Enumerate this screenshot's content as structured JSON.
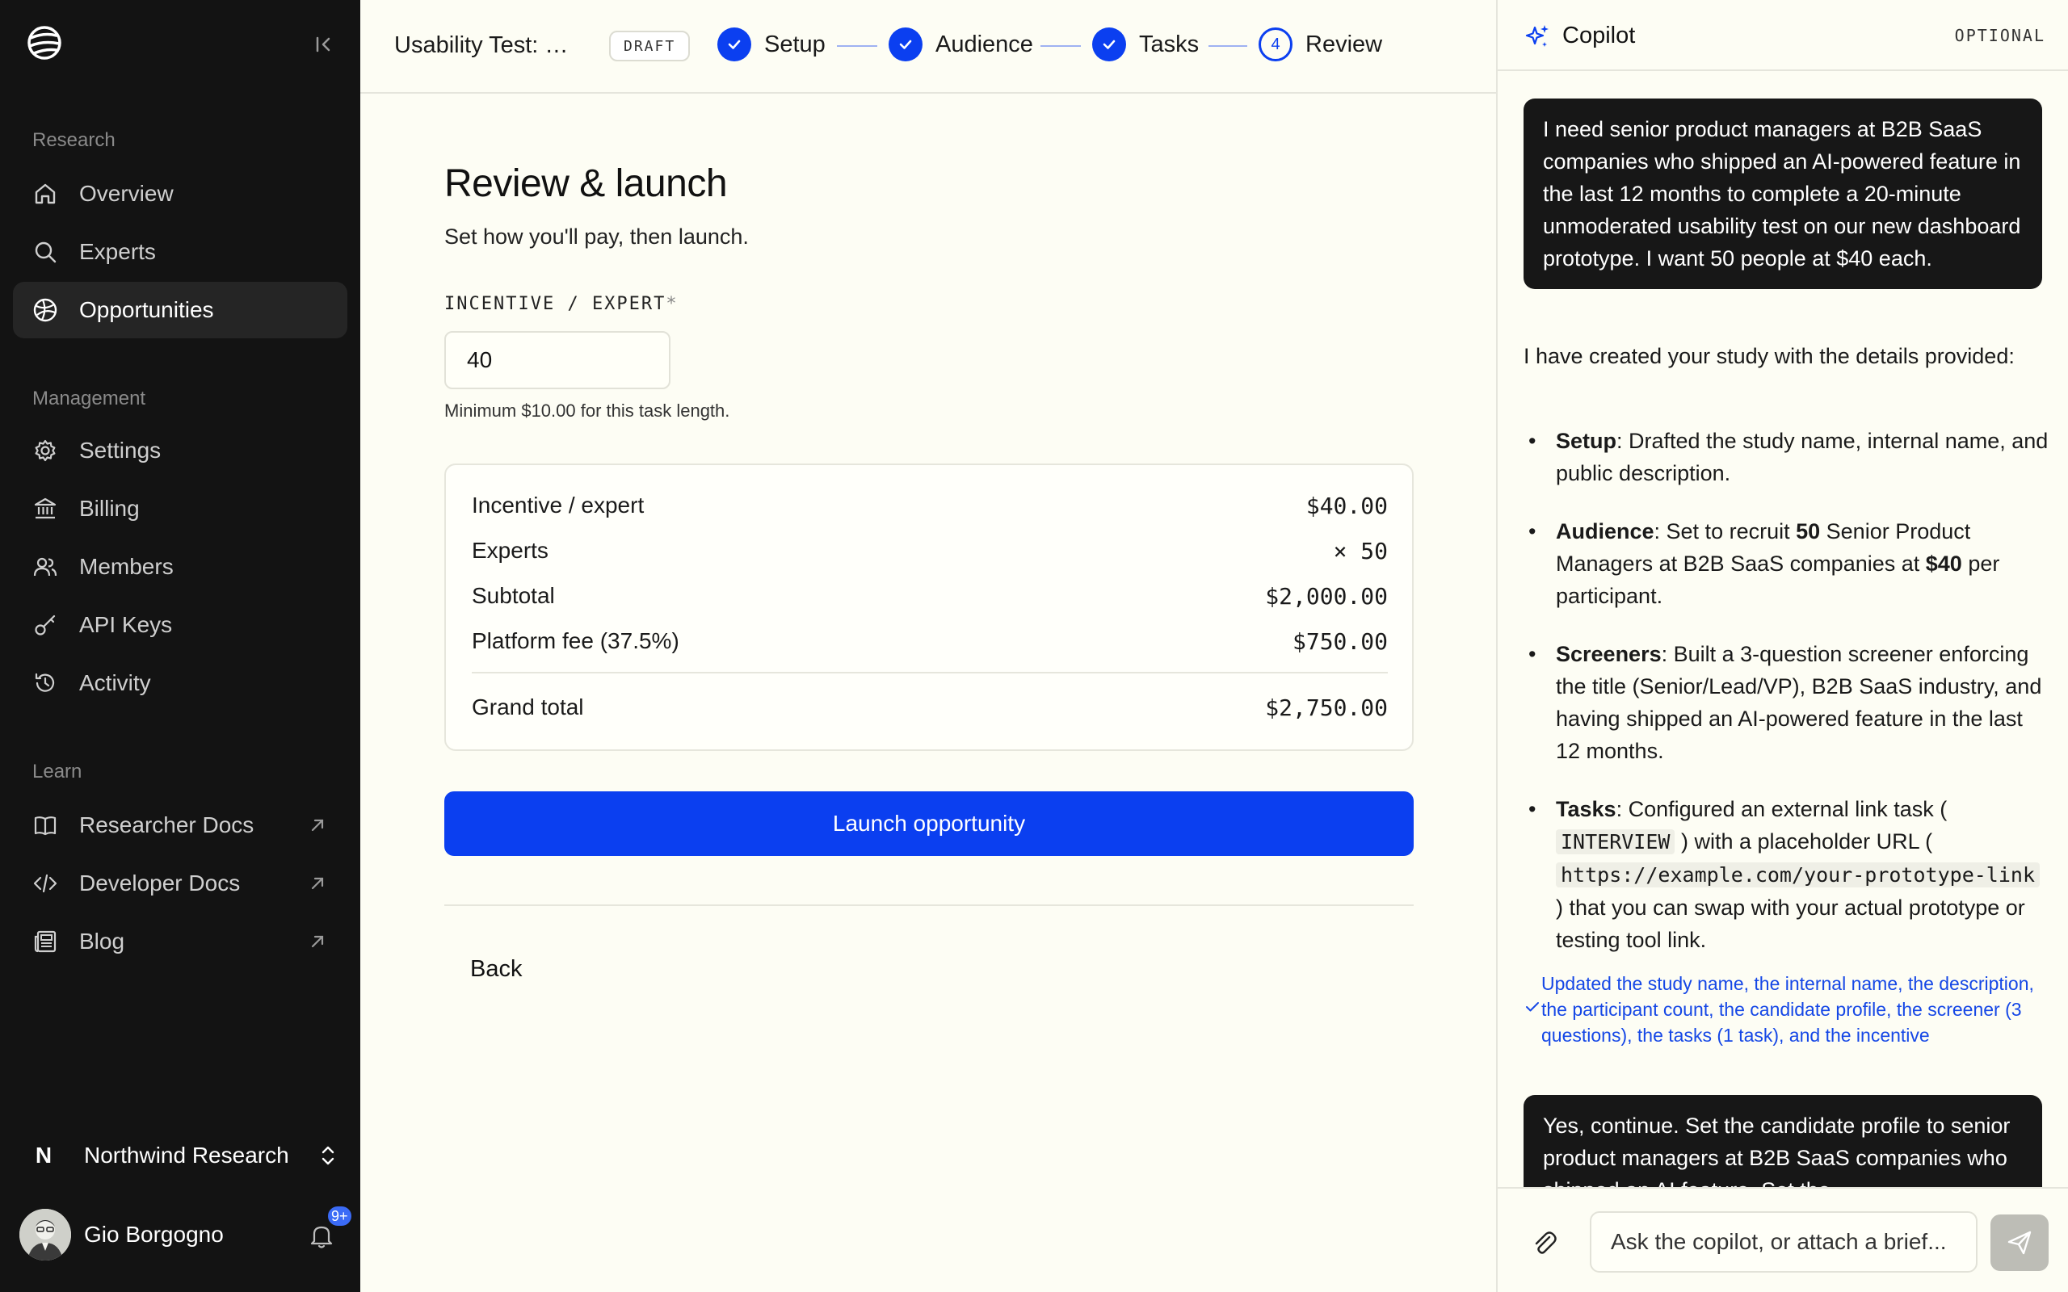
{
  "sidebar": {
    "sections": {
      "research": "Research",
      "management": "Management",
      "learn": "Learn"
    },
    "items": [
      {
        "label": "Overview",
        "icon": "home-icon"
      },
      {
        "label": "Experts",
        "icon": "search-icon"
      },
      {
        "label": "Opportunities",
        "icon": "globe-icon",
        "active": true
      },
      {
        "label": "Settings",
        "icon": "gear-icon"
      },
      {
        "label": "Billing",
        "icon": "bank-icon"
      },
      {
        "label": "Members",
        "icon": "users-icon"
      },
      {
        "label": "API Keys",
        "icon": "key-icon"
      },
      {
        "label": "Activity",
        "icon": "history-icon"
      },
      {
        "label": "Researcher Docs",
        "icon": "book-icon",
        "external": true
      },
      {
        "label": "Developer Docs",
        "icon": "code-icon",
        "external": true
      },
      {
        "label": "Blog",
        "icon": "newspaper-icon",
        "external": true
      }
    ],
    "org": {
      "initial": "N",
      "name": "Northwind Research"
    },
    "user": {
      "name": "Gio Borgogno",
      "notifications": "9+"
    }
  },
  "header": {
    "study_title": "Usability Test: N...",
    "status": "DRAFT",
    "steps": [
      {
        "label": "Setup",
        "state": "done"
      },
      {
        "label": "Audience",
        "state": "done"
      },
      {
        "label": "Tasks",
        "state": "done"
      },
      {
        "label": "Review",
        "state": "current",
        "number": "4"
      }
    ]
  },
  "main": {
    "title": "Review & launch",
    "subtitle": "Set how you'll pay, then launch.",
    "incentive_label": "INCENTIVE / EXPERT",
    "required_mark": "*",
    "incentive_value": "40",
    "hint": "Minimum $10.00 for this task length.",
    "summary": [
      {
        "label": "Incentive / expert",
        "value": "$40.00"
      },
      {
        "label": "Experts",
        "value": "× 50"
      },
      {
        "label": "Subtotal",
        "value": "$2,000.00"
      },
      {
        "label": "Platform fee (37.5%)",
        "value": "$750.00"
      }
    ],
    "grand_total": {
      "label": "Grand total",
      "value": "$2,750.00"
    },
    "launch_label": "Launch opportunity",
    "back_label": "Back"
  },
  "copilot": {
    "title": "Copilot",
    "optional": "OPTIONAL",
    "user_message_1": "I need senior product managers at B2B SaaS companies who shipped an AI-powered feature in the last 12 months to complete a 20-minute unmoderated usability test on our new dashboard prototype. I want 50 people at $40 each.",
    "reply_intro": "I have created your study with the details provided:",
    "bullets": {
      "setup_title": "Setup",
      "setup_text": ": Drafted the study name, internal name, and public description.",
      "audience_title": "Audience",
      "audience_text_1": ": Set to recruit ",
      "audience_count": "50",
      "audience_text_2": " Senior Product Managers at B2B SaaS companies at ",
      "audience_price": "$40",
      "audience_text_3": " per participant.",
      "screeners_title": "Screeners",
      "screeners_text": ": Built a 3-question screener enforcing the title (Senior/Lead/VP), B2B SaaS industry, and having shipped an AI-powered feature in the last 12 months.",
      "tasks_title": "Tasks",
      "tasks_text_1": ": Configured an external link task ( ",
      "tasks_code_1": "INTERVIEW",
      "tasks_text_2": " ) with a placeholder URL ( ",
      "tasks_code_2": "https://example.com/your-prototype-link",
      "tasks_text_3": " ) that you can swap with your actual prototype or testing tool link."
    },
    "updated_note": "Updated the study name, the internal name, the description, the participant count, the candidate profile, the screener (3 questions), the tasks (1 task), and the incentive",
    "user_message_2": "Yes, continue. Set the candidate profile to senior product managers at B2B SaaS companies who shipped an AI feature. Set the",
    "input_placeholder": "Ask the copilot, or attach a brief..."
  },
  "colors": {
    "accent": "#0b3ff0",
    "sidebar_bg": "#131313",
    "page_bg": "#fdfdf4",
    "note_text": "#1547e6"
  }
}
